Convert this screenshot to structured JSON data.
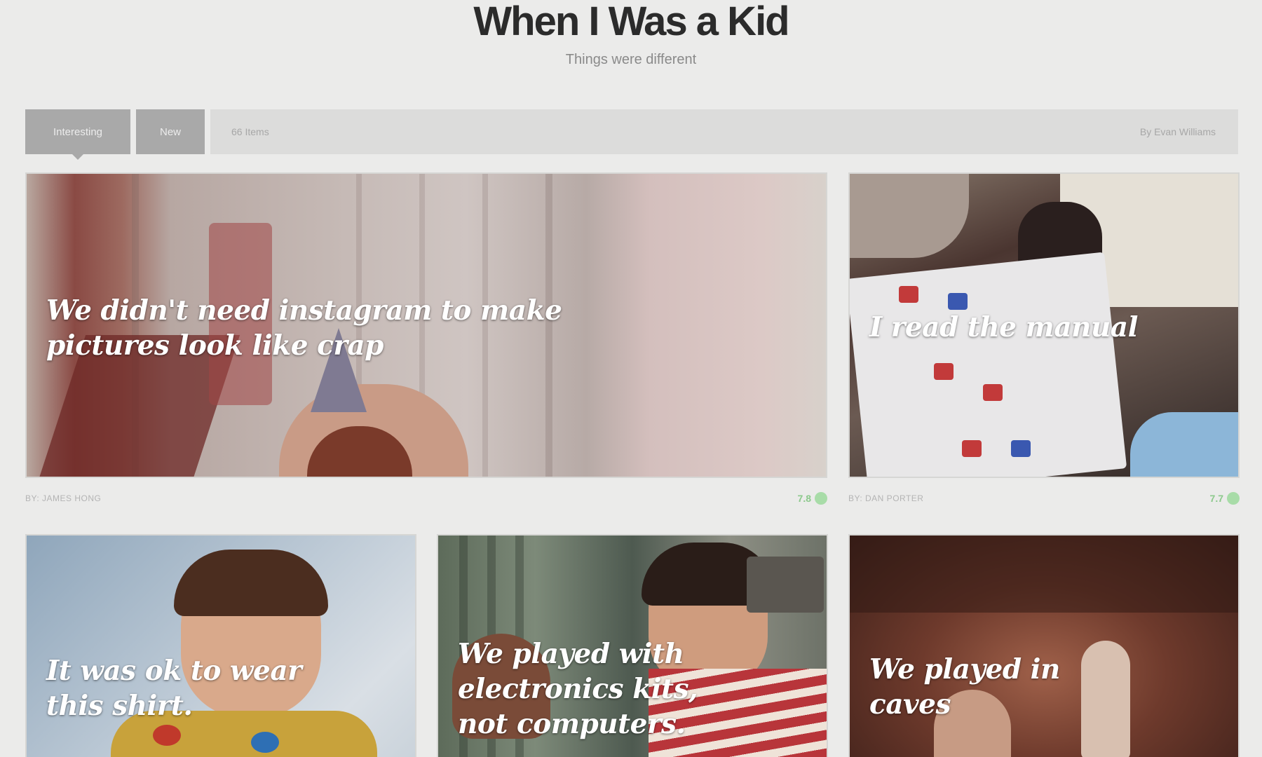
{
  "header": {
    "title": "When I Was a Kid",
    "subtitle": "Things were different"
  },
  "toolbar": {
    "tabs": [
      {
        "label": "Interesting",
        "active": true
      },
      {
        "label": "New",
        "active": false
      }
    ],
    "item_count": "66 Items",
    "byline": "By Evan Williams"
  },
  "cards": [
    {
      "caption_lines": [
        "We didn't need instagram to make",
        "pictures look like crap"
      ],
      "author": "BY: JAMES HONG",
      "score": "7.8"
    },
    {
      "caption_lines": [
        "I read the manual"
      ],
      "author": "BY: DAN PORTER",
      "score": "7.7"
    },
    {
      "caption_lines": [
        "It was ok to wear",
        "this shirt."
      ],
      "author": "",
      "score": ""
    },
    {
      "caption_lines": [
        "We played with",
        "electronics kits,",
        "not computers."
      ],
      "author": "",
      "score": ""
    },
    {
      "caption_lines": [
        "We played in",
        "caves"
      ],
      "author": "",
      "score": ""
    }
  ],
  "colors": {
    "background": "#ebebea",
    "tab": "#a9a9a9",
    "bar": "#dcdcdb",
    "score": "#8cc98c"
  },
  "icons": {
    "score": "score-dot-icon"
  }
}
